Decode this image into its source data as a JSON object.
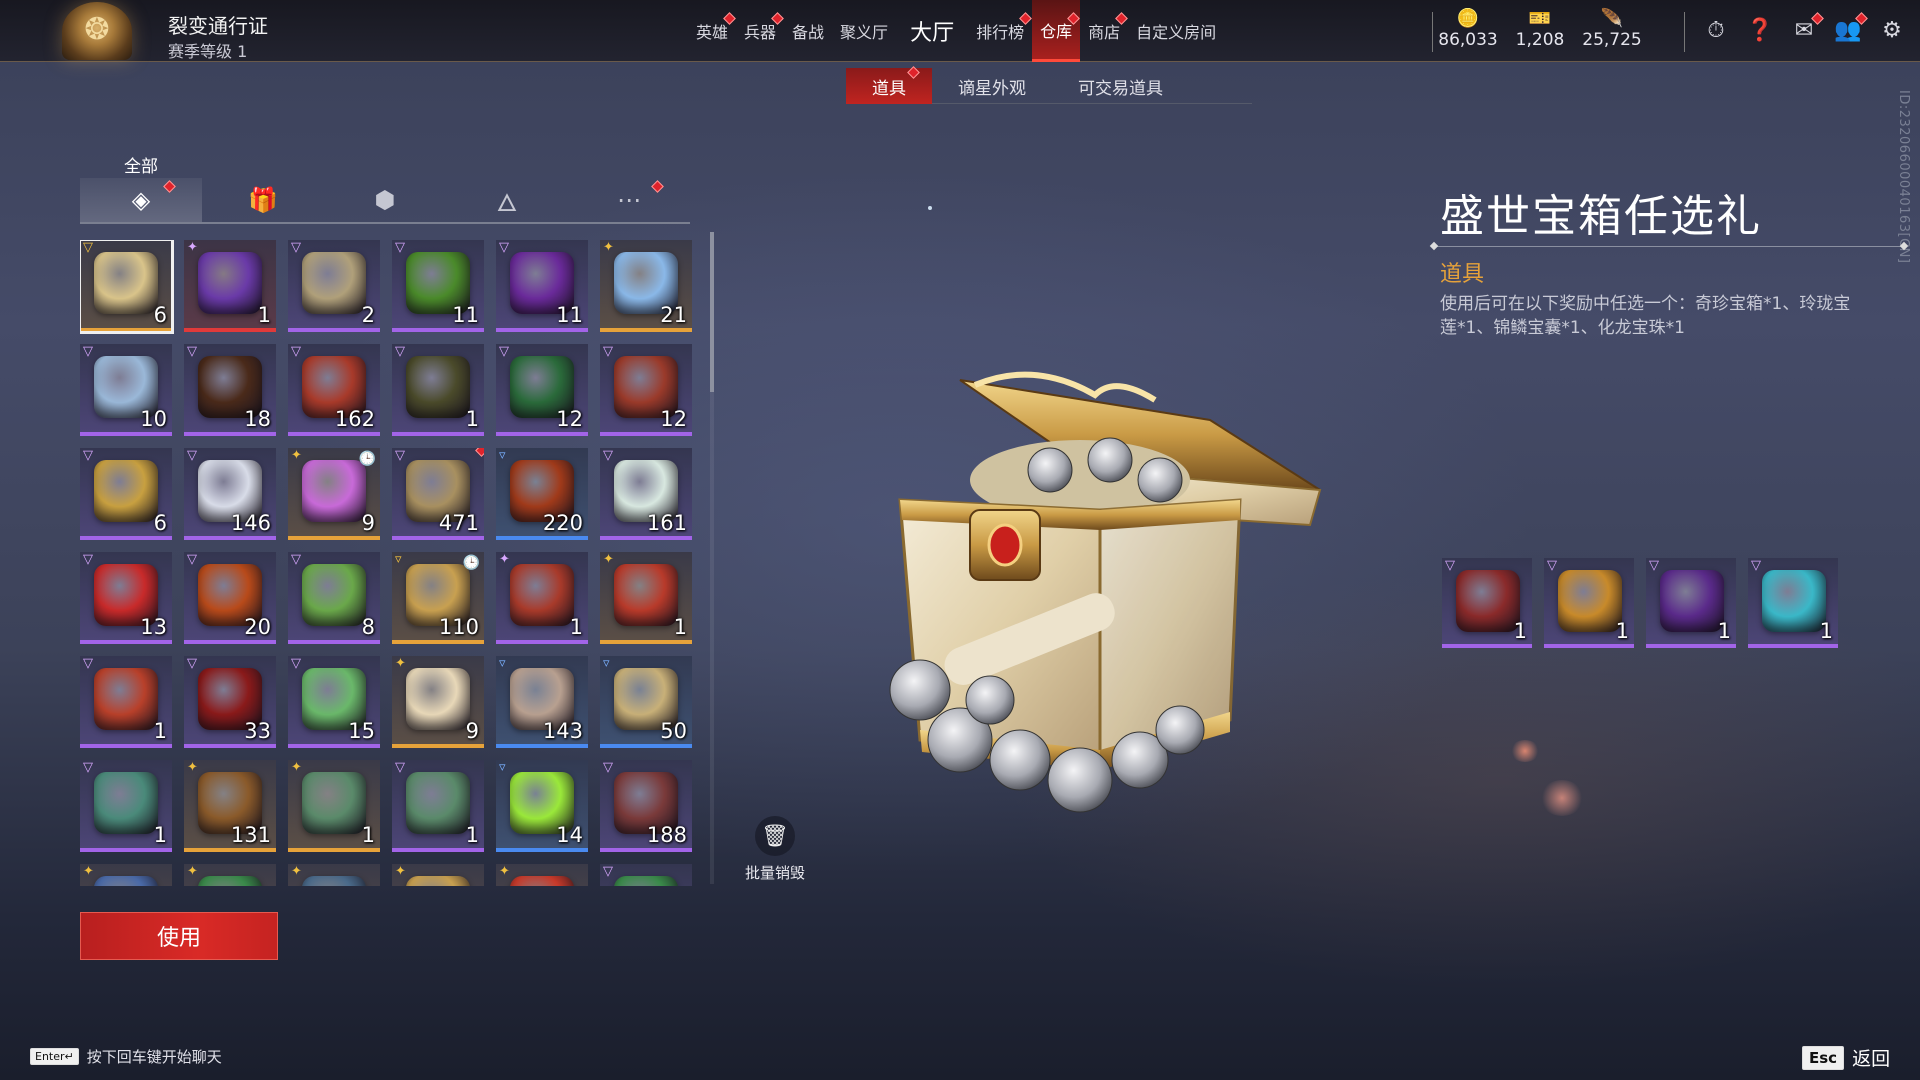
{
  "pass": {
    "title": "裂变通行证",
    "level": "赛季等级 1"
  },
  "nav": [
    {
      "label": "英雄",
      "dot": true
    },
    {
      "label": "兵器",
      "dot": true
    },
    {
      "label": "备战",
      "dot": false
    },
    {
      "label": "聚义厅",
      "dot": false
    },
    {
      "label": "大厅",
      "dot": false,
      "big": true
    },
    {
      "label": "排行榜",
      "dot": true
    },
    {
      "label": "仓库",
      "dot": true,
      "active": true
    },
    {
      "label": "商店",
      "dot": true
    },
    {
      "label": "自定义房间",
      "dot": false
    }
  ],
  "currencies": [
    {
      "icon": "🪙",
      "icon_name": "coin-icon",
      "value": "86,033",
      "color": "#d0d6e4"
    },
    {
      "icon": "🎫",
      "icon_name": "ticket-icon",
      "value": "1,208",
      "color": "#e6b45a"
    },
    {
      "icon": "🪶",
      "icon_name": "feather-icon",
      "value": "25,725",
      "color": "#3fc6c6"
    }
  ],
  "top_icons": [
    {
      "name": "stopwatch-icon",
      "glyph": "⏱",
      "dot": false
    },
    {
      "name": "help-icon",
      "glyph": "❓",
      "dot": false
    },
    {
      "name": "mail-icon",
      "glyph": "✉",
      "dot": true
    },
    {
      "name": "friends-icon",
      "glyph": "👥",
      "dot": true
    },
    {
      "name": "settings-icon",
      "glyph": "⚙",
      "dot": false
    }
  ],
  "side_id": "ID:23206600040163[CN]",
  "subtabs": [
    {
      "label": "道具",
      "active": true,
      "dot": true
    },
    {
      "label": "谪星外观",
      "active": false,
      "dot": false
    },
    {
      "label": "可交易道具",
      "active": false,
      "dot": false
    }
  ],
  "category_label": "全部",
  "categories": [
    {
      "name": "all-items-icon",
      "glyph": "◈",
      "active": true,
      "dot": true
    },
    {
      "name": "gift-icon",
      "glyph": "🎁",
      "active": false,
      "dot": false
    },
    {
      "name": "badge-icon",
      "glyph": "⬢",
      "active": false,
      "dot": false
    },
    {
      "name": "flame-icon",
      "glyph": "🜂",
      "active": false,
      "dot": false
    },
    {
      "name": "more-icon",
      "glyph": "⋯",
      "active": false,
      "dot": true
    }
  ],
  "items": [
    {
      "count": "6",
      "q": "gold",
      "badge": "▽",
      "color": "#d9c48a",
      "selected": true
    },
    {
      "count": "1",
      "q": "red",
      "badge": "✦",
      "color": "#6a3aa8"
    },
    {
      "count": "2",
      "q": "purple",
      "badge": "▽",
      "color": "#b0a07a"
    },
    {
      "count": "11",
      "q": "purple",
      "badge": "▽",
      "color": "#4a8a2a"
    },
    {
      "count": "11",
      "q": "purple",
      "badge": "▽",
      "color": "#6a2a9a"
    },
    {
      "count": "21",
      "q": "gold",
      "badge": "✦",
      "color": "#8ab8e8"
    },
    {
      "count": "10",
      "q": "purple",
      "badge": "▽",
      "color": "#9ab8d8"
    },
    {
      "count": "18",
      "q": "purple",
      "badge": "▽",
      "color": "#4a2a1a"
    },
    {
      "count": "162",
      "q": "purple",
      "badge": "▽",
      "color": "#a83a2a"
    },
    {
      "count": "1",
      "q": "purple",
      "badge": "▽",
      "color": "#4a4a2a"
    },
    {
      "count": "12",
      "q": "purple",
      "badge": "▽",
      "color": "#2a6a3a"
    },
    {
      "count": "12",
      "q": "purple",
      "badge": "▽",
      "color": "#9a3a2a"
    },
    {
      "count": "6",
      "q": "purple",
      "badge": "▽",
      "color": "#c8a040"
    },
    {
      "count": "146",
      "q": "purple",
      "badge": "▽",
      "color": "#d8dce8"
    },
    {
      "count": "9",
      "q": "gold",
      "badge": "✦",
      "color": "#c86ad8",
      "timer": true
    },
    {
      "count": "471",
      "q": "purple",
      "badge": "▽",
      "color": "#a89060",
      "dot": true
    },
    {
      "count": "220",
      "q": "blue",
      "badge": "▿",
      "color": "#a03a1a"
    },
    {
      "count": "161",
      "q": "purple",
      "badge": "▽",
      "color": "#d8e8e0"
    },
    {
      "count": "13",
      "q": "purple",
      "badge": "▽",
      "color": "#c82a2a"
    },
    {
      "count": "20",
      "q": "purple",
      "badge": "▽",
      "color": "#b84a1a"
    },
    {
      "count": "8",
      "q": "purple",
      "badge": "▽",
      "color": "#6aa84a"
    },
    {
      "count": "110",
      "q": "gold",
      "badge": "▿",
      "color": "#c8a050",
      "timer": true
    },
    {
      "count": "1",
      "q": "purple",
      "badge": "✦",
      "color": "#a83a2a"
    },
    {
      "count": "1",
      "q": "gold",
      "badge": "✦",
      "color": "#b83a2a"
    },
    {
      "count": "1",
      "q": "purple",
      "badge": "▽",
      "color": "#b8402a"
    },
    {
      "count": "33",
      "q": "purple",
      "badge": "▽",
      "color": "#8a1a1a"
    },
    {
      "count": "15",
      "q": "purple",
      "badge": "▽",
      "color": "#6ab86a"
    },
    {
      "count": "9",
      "q": "gold",
      "badge": "✦",
      "color": "#e8d8b8"
    },
    {
      "count": "143",
      "q": "blue",
      "badge": "▿",
      "color": "#b8a090"
    },
    {
      "count": "50",
      "q": "blue",
      "badge": "▿",
      "color": "#c8b078"
    },
    {
      "count": "1",
      "q": "purple",
      "badge": "▽",
      "color": "#4a8a7a"
    },
    {
      "count": "131",
      "q": "gold",
      "badge": "✦",
      "color": "#8a5a2a"
    },
    {
      "count": "1",
      "q": "gold",
      "badge": "✦",
      "color": "#5a8a6a"
    },
    {
      "count": "1",
      "q": "purple",
      "badge": "▽",
      "color": "#5a8a6a"
    },
    {
      "count": "14",
      "q": "blue",
      "badge": "▿",
      "color": "#9ae83a"
    },
    {
      "count": "188",
      "q": "purple",
      "badge": "▽",
      "color": "#7a3a3a"
    },
    {
      "count": "",
      "q": "gold",
      "badge": "✦",
      "color": "#4a6aa8"
    },
    {
      "count": "",
      "q": "gold",
      "badge": "✦",
      "color": "#3a8a4a"
    },
    {
      "count": "",
      "q": "gold",
      "badge": "✦",
      "color": "#4a6a8a"
    },
    {
      "count": "",
      "q": "gold",
      "badge": "✦",
      "color": "#c8a050"
    },
    {
      "count": "",
      "q": "gold",
      "badge": "✦",
      "color": "#c83a2a"
    },
    {
      "count": "",
      "q": "purple",
      "badge": "▽",
      "color": "#3a8a4a"
    }
  ],
  "use_button": "使用",
  "bulk_destroy": "批量销毁",
  "detail": {
    "title": "盛世宝箱任选礼",
    "type": "道具",
    "description": "使用后可在以下奖励中任选一个：奇珍宝箱*1、玲珑宝莲*1、锦鳞宝囊*1、化龙宝珠*1"
  },
  "rewards": [
    {
      "count": "1",
      "q": "purple",
      "badge": "▽",
      "color": "#8a2a2a"
    },
    {
      "count": "1",
      "q": "purple",
      "badge": "▽",
      "color": "#c88a2a"
    },
    {
      "count": "1",
      "q": "purple",
      "badge": "▽",
      "color": "#5a2a8a"
    },
    {
      "count": "1",
      "q": "purple",
      "badge": "▽",
      "color": "#3ab8c8"
    }
  ],
  "footer": {
    "enter_key": "Enter↵",
    "chat_hint": "按下回车键开始聊天",
    "esc_key": "Esc",
    "back": "返回"
  }
}
